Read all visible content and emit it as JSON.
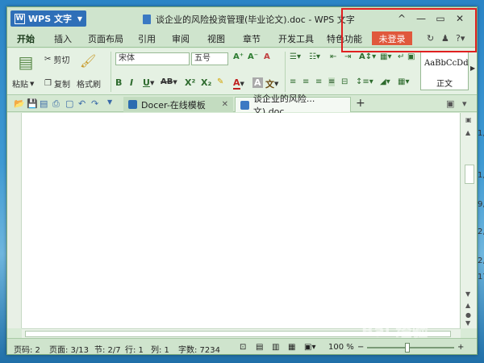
{
  "desktop": {
    "fragments": [
      "1,",
      "1,",
      "9,",
      "2,",
      "2,",
      "17,"
    ]
  },
  "titlebar": {
    "app_menu": "WPS 文字",
    "document_title": "谈企业的风险投资管理(毕业论文).doc - WPS 文字",
    "minimize_glyph": "—",
    "maximize_glyph": "▭",
    "close_glyph": "✕",
    "collapse_glyph": "^"
  },
  "menu_tabs": [
    "开始",
    "插入",
    "页面布局",
    "引用",
    "审阅",
    "视图",
    "章节",
    "开发工具",
    "特色功能"
  ],
  "login_button": "未登录",
  "ribbon": {
    "paste": "粘贴",
    "cut": "剪切",
    "copy": "复制",
    "format_painter": "格式刷",
    "font_name": "宋体",
    "font_size": "五号",
    "bold": "B",
    "italic": "I",
    "underline": "U",
    "strike": "AB",
    "superscript": "X²",
    "subscript": "X₂",
    "font_color": "A",
    "char_shade": "A",
    "phonetic": "文",
    "style_sample": "AaBbCcDd",
    "style_name": "正文"
  },
  "doc_tabs": {
    "docer": "Docer-在线模板",
    "document": "谈企业的风险...文).doc",
    "add": "+"
  },
  "status": {
    "page_code": "页码: 2",
    "page": "页面: 3/13",
    "section": "节: 2/7",
    "row": "行: 1",
    "column": "列: 1",
    "word_count": "字数: 7234",
    "zoom": "100 %"
  },
  "watermark": "Bai 经验"
}
